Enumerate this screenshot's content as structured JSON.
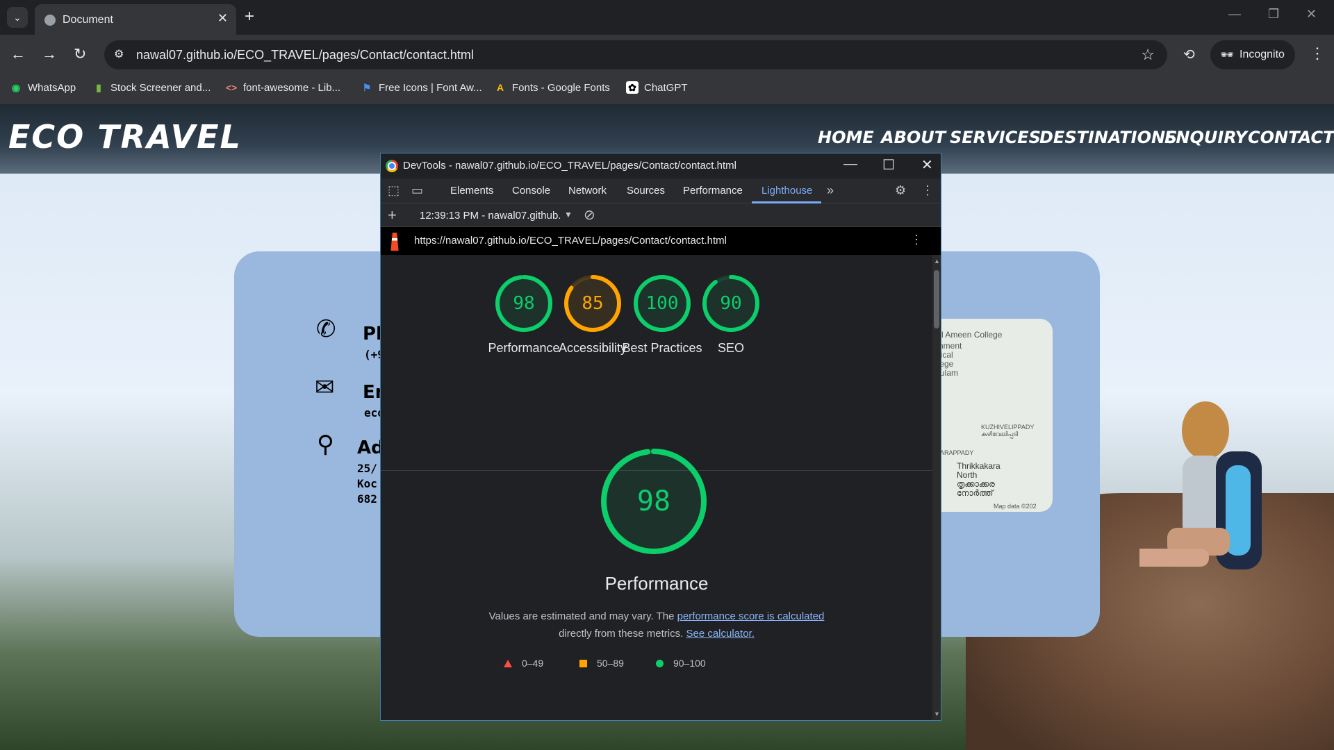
{
  "browser": {
    "tab_title": "Document",
    "url": "nawal07.github.io/ECO_TRAVEL/pages/Contact/contact.html",
    "incognito_label": "Incognito",
    "bookmarks": [
      "WhatsApp",
      "Stock Screener and...",
      "font-awesome - Lib...",
      "Free Icons | Font Aw...",
      "Fonts - Google Fonts",
      "ChatGPT"
    ]
  },
  "site": {
    "logo": "ECO TRAVEL",
    "nav": [
      "HOME",
      "ABOUT",
      "SERVICES",
      "DESTINATIONS",
      "ENQUIRY",
      "CONTACT"
    ],
    "contact": {
      "phone_title": "Ph",
      "phone_text": "(+9",
      "email_title": "Em",
      "email_text": "eco",
      "address_title": "Add",
      "address_lines": [
        "25/",
        "Koc",
        "682"
      ]
    },
    "map_labels": [
      "Al Ameen College",
      "rnment",
      "dical",
      "llege",
      "kulam",
      "KUZHIVELIPPADY",
      "കുഴിവേലിപ്പടി",
      "SARAPPADY",
      "Thrikkakara",
      "North",
      "തൃക്കാക്കര",
      "നോർത്ത്",
      "Map data ©202"
    ]
  },
  "devtools": {
    "window_title": "DevTools - nawal07.github.io/ECO_TRAVEL/pages/Contact/contact.html",
    "tabs": [
      "Elements",
      "Console",
      "Network",
      "Sources",
      "Performance",
      "Lighthouse"
    ],
    "active_tab": "Lighthouse",
    "report_selector": "12:39:13 PM - nawal07.github.",
    "report_url": "https://nawal07.github.io/ECO_TRAVEL/pages/Contact/contact.html",
    "categories": [
      {
        "label": "Performance",
        "score": 98,
        "color": "#0cce6b"
      },
      {
        "label": "Accessibility",
        "score": 85,
        "color": "#ffa400"
      },
      {
        "label": "Best Practices",
        "score": 100,
        "color": "#0cce6b"
      },
      {
        "label": "SEO",
        "score": 90,
        "color": "#0cce6b"
      }
    ],
    "main_score": {
      "label": "Performance",
      "score": 98
    },
    "description": {
      "part1": "Values are estimated and may vary. The ",
      "link1": "performance score is calculated",
      "part2": "directly from these metrics. ",
      "link2": "See calculator."
    },
    "legend": [
      {
        "range": "0–49",
        "shape": "triangle",
        "color": "#ff4e42"
      },
      {
        "range": "50–89",
        "shape": "square",
        "color": "#ffa400"
      },
      {
        "range": "90–100",
        "shape": "circle",
        "color": "#0cce6b"
      }
    ]
  }
}
